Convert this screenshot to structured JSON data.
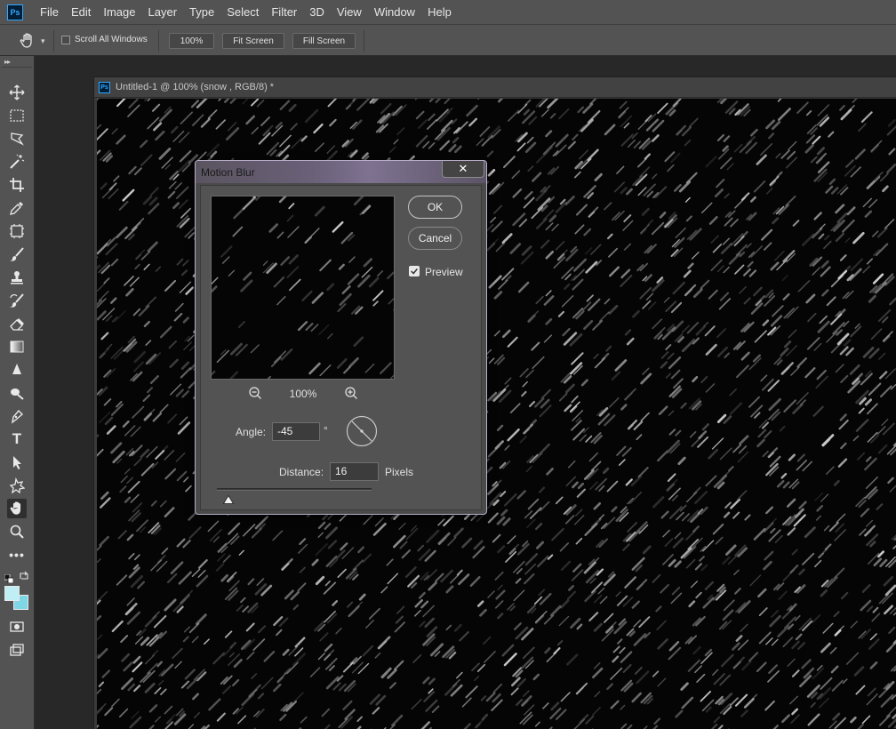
{
  "menubar": {
    "logo": "Ps",
    "items": [
      "File",
      "Edit",
      "Image",
      "Layer",
      "Type",
      "Select",
      "Filter",
      "3D",
      "View",
      "Window",
      "Help"
    ]
  },
  "options": {
    "scroll_all_windows": "Scroll All Windows",
    "scroll_all_checked": false,
    "zoom_100": "100%",
    "fit_screen": "Fit Screen",
    "fill_screen": "Fill Screen"
  },
  "tools": [
    "move-icon",
    "marquee-icon",
    "lasso-icon",
    "magic-wand-icon",
    "crop-icon",
    "eyedropper-icon",
    "frame-icon",
    "brush-icon",
    "stamp-icon",
    "history-brush-icon",
    "eraser-icon",
    "gradient-icon",
    "blur-icon",
    "dodge-icon",
    "pen-icon",
    "type-icon",
    "path-selection-icon",
    "shape-icon",
    "hand-icon",
    "zoom-icon",
    "more-tools-icon"
  ],
  "colors": {
    "foreground": "#bfeef5",
    "background": "#7fd7e6"
  },
  "document": {
    "logo": "Ps",
    "title": "Untitled-1 @ 100% (snow , RGB/8) *"
  },
  "dialog": {
    "title": "Motion Blur",
    "close": "✕",
    "ok": "OK",
    "cancel": "Cancel",
    "preview_label": "Preview",
    "preview_checked": true,
    "zoom": "100%",
    "angle_label": "Angle:",
    "angle_value": "-45",
    "degree": "°",
    "distance_label": "Distance:",
    "distance_value": "16",
    "distance_unit": "Pixels"
  }
}
